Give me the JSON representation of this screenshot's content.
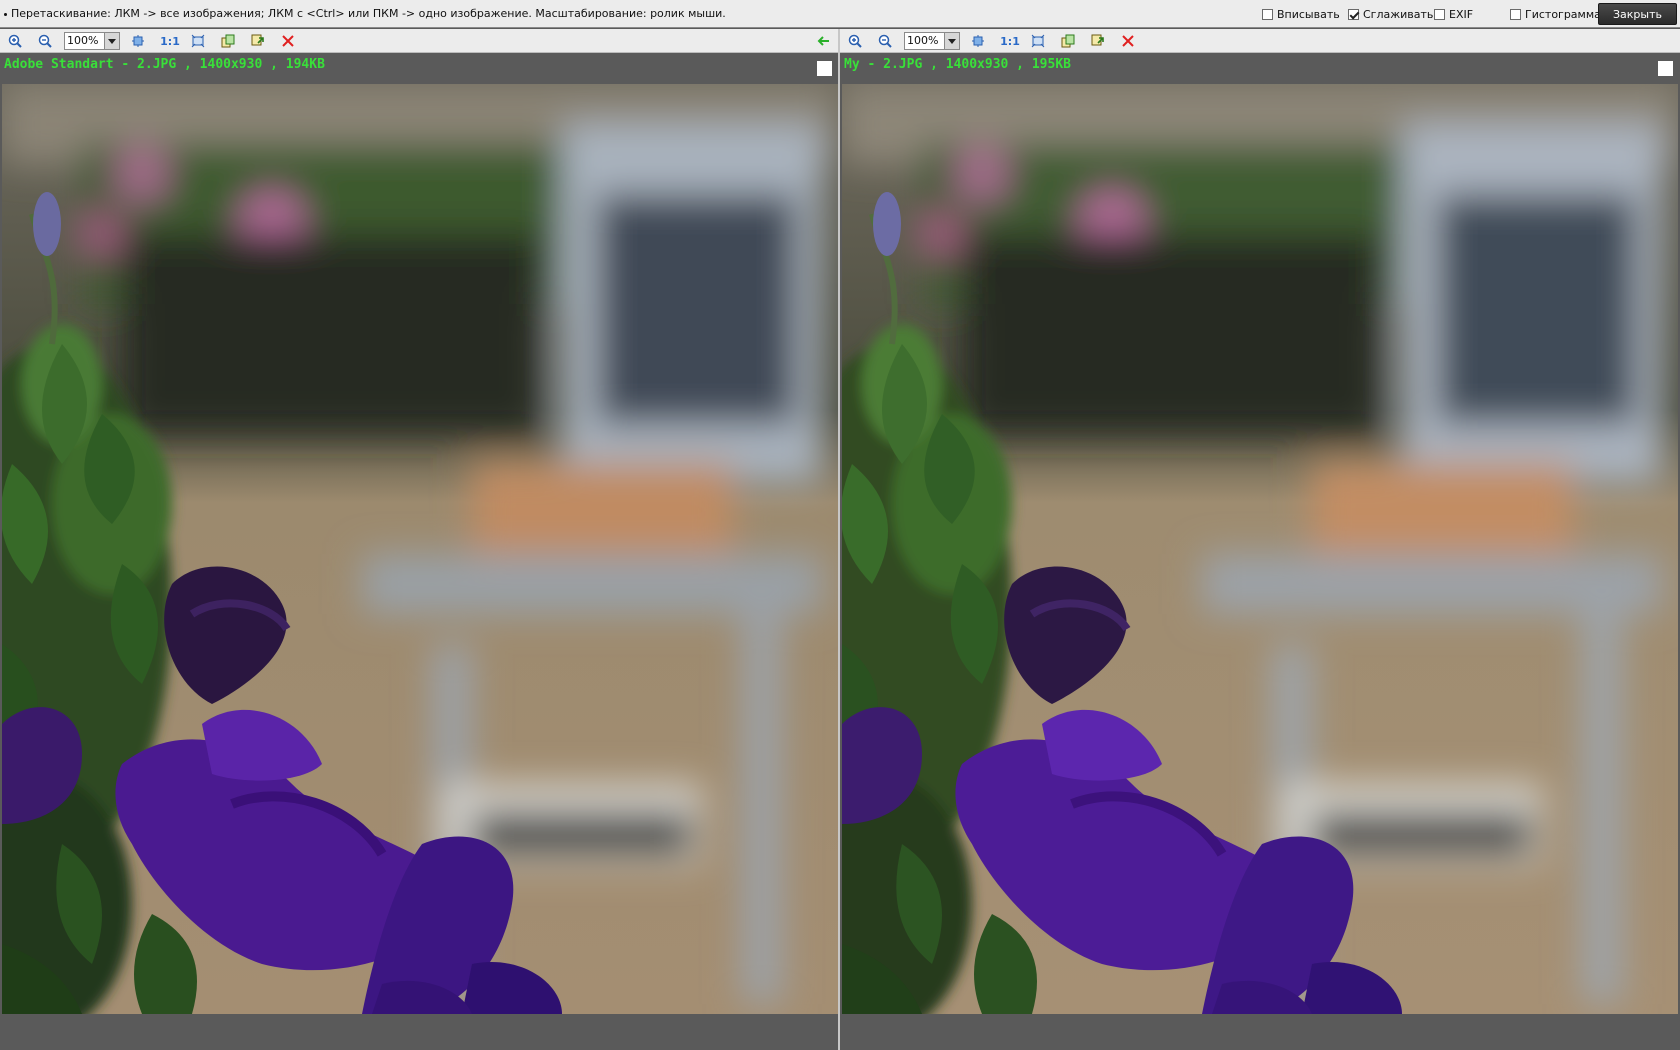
{
  "topbar": {
    "hint": "Перетаскивание: ЛКМ -> все изображения; ЛКМ с <Ctrl> или ПКМ -> одно изображение. Масштабирование: ролик мыши.",
    "options": [
      {
        "label": "Вписывать",
        "checked": false
      },
      {
        "label": "Сглаживать",
        "checked": true
      },
      {
        "label": "EXIF",
        "checked": false
      },
      {
        "label": "Гистограмма",
        "checked": false
      }
    ],
    "close_label": "Закрыть"
  },
  "panels": [
    {
      "zoom": "100%",
      "one_to_one": "1:1",
      "caption": "Adobe Standart - 2.JPG , 1400x930 , 194KB",
      "image_alt": "Purple petunia flowers with blurred chair background"
    },
    {
      "zoom": "100%",
      "one_to_one": "1:1",
      "caption": "My - 2.JPG , 1400x930 , 195KB",
      "image_alt": "Purple petunia flowers with blurred chair background"
    }
  ],
  "icons": {
    "zoom_in": "zoom-in-icon",
    "zoom_out": "zoom-out-icon",
    "fit": "fit-icon",
    "fullscreen": "fullscreen-icon",
    "copy": "copy-icon",
    "save": "save-icon",
    "delete": "delete-icon",
    "back": "arrow-left-icon"
  },
  "colors": {
    "caption": "#39e039",
    "toolbar_bg": "#ececec",
    "panel_bg": "#5a5a5a"
  }
}
